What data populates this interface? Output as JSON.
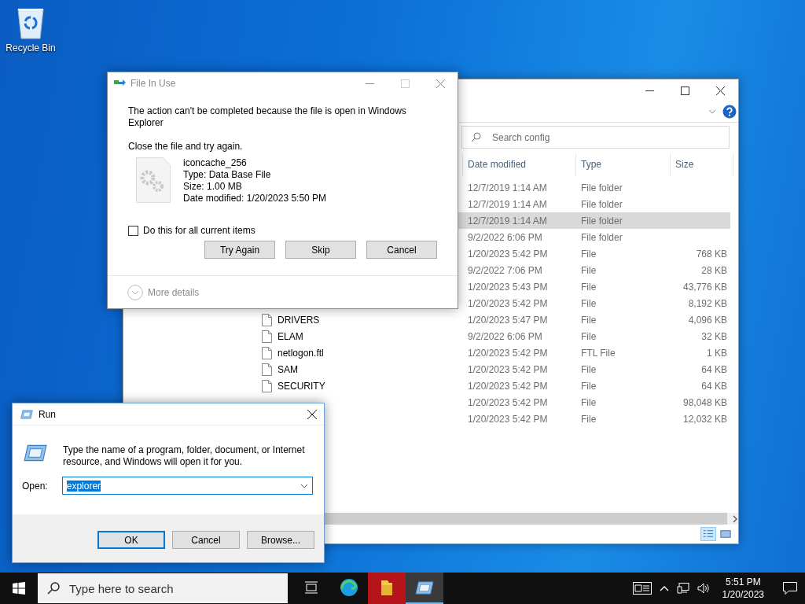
{
  "desktop_icons": [
    {
      "label": "Recycle Bin"
    }
  ],
  "explorer": {
    "search": {
      "placeholder": "Search config"
    },
    "columns": [
      "Date modified",
      "Type",
      "Size"
    ],
    "rows": [
      {
        "date": "12/7/2019 1:14 AM",
        "type": "File folder",
        "selected": false
      },
      {
        "date": "12/7/2019 1:14 AM",
        "type": "File folder",
        "selected": false
      },
      {
        "date": "12/7/2019 1:14 AM",
        "type": "File folder",
        "selected": true
      },
      {
        "date": "9/2/2022 6:06 PM",
        "type": "File folder",
        "selected": false
      },
      {
        "date": "1/20/2023 5:42 PM",
        "type": "File",
        "size": "768 KB",
        "selected": false
      },
      {
        "date": "9/2/2022 7:06 PM",
        "type": "File",
        "size": "28 KB",
        "selected": false
      },
      {
        "date": "1/20/2023 5:43 PM",
        "type": "File",
        "size": "43,776 KB",
        "selected": false
      },
      {
        "date": "1/20/2023 5:42 PM",
        "type": "File",
        "size": "8,192 KB",
        "selected": false
      },
      {
        "name": "DRIVERS",
        "date": "1/20/2023 5:47 PM",
        "type": "File",
        "size": "4,096 KB",
        "selected": false
      },
      {
        "name": "ELAM",
        "date": "9/2/2022 6:06 PM",
        "type": "File",
        "size": "32 KB",
        "selected": false
      },
      {
        "name": "netlogon.ftl",
        "date": "1/20/2023 5:42 PM",
        "type": "FTL File",
        "size": "1 KB",
        "selected": false
      },
      {
        "name": "SAM",
        "date": "1/20/2023 5:42 PM",
        "type": "File",
        "size": "64 KB",
        "selected": false
      },
      {
        "name": "SECURITY",
        "date": "1/20/2023 5:42 PM",
        "type": "File",
        "size": "64 KB",
        "selected": false
      },
      {
        "date": "1/20/2023 5:42 PM",
        "type": "File",
        "size": "98,048 KB",
        "selected": false
      },
      {
        "date": "1/20/2023 5:42 PM",
        "type": "File",
        "size": "12,032 KB",
        "selected": false
      }
    ],
    "view_buttons": [
      {
        "kind": "details",
        "selected": true
      },
      {
        "kind": "large-icons",
        "selected": false
      }
    ]
  },
  "file_in_use": {
    "title": "File In Use",
    "message": "The action can't be completed because the file is open in Windows Explorer",
    "instruction": "Close the file and try again.",
    "file": {
      "name": "iconcache_256",
      "type": "Type: Data Base File",
      "size": "Size: 1.00 MB",
      "modified": "Date modified: 1/20/2023 5:50 PM"
    },
    "checkbox": {
      "label": "Do this for all current items",
      "checked": false
    },
    "buttons": [
      "Try Again",
      "Skip",
      "Cancel"
    ],
    "more_details": "More details"
  },
  "run": {
    "title": "Run",
    "message": "Type the name of a program, folder, document, or Internet resource, and Windows will open it for you.",
    "open_label": "Open:",
    "value": "explorer",
    "buttons": [
      {
        "label": "OK",
        "default": true
      },
      {
        "label": "Cancel",
        "default": false
      },
      {
        "label": "Browse...",
        "default": false
      }
    ]
  },
  "taskbar": {
    "search": {
      "placeholder": "Type here to search"
    },
    "apps": [
      {
        "kind": "task-view",
        "active": false,
        "flashing": false
      },
      {
        "kind": "browser",
        "active": false,
        "flashing": false
      },
      {
        "kind": "files",
        "active": false,
        "flashing": true
      },
      {
        "kind": "run",
        "active": true,
        "flashing": false
      }
    ],
    "clock": {
      "time": "5:51 PM",
      "date": "1/20/2023"
    }
  }
}
